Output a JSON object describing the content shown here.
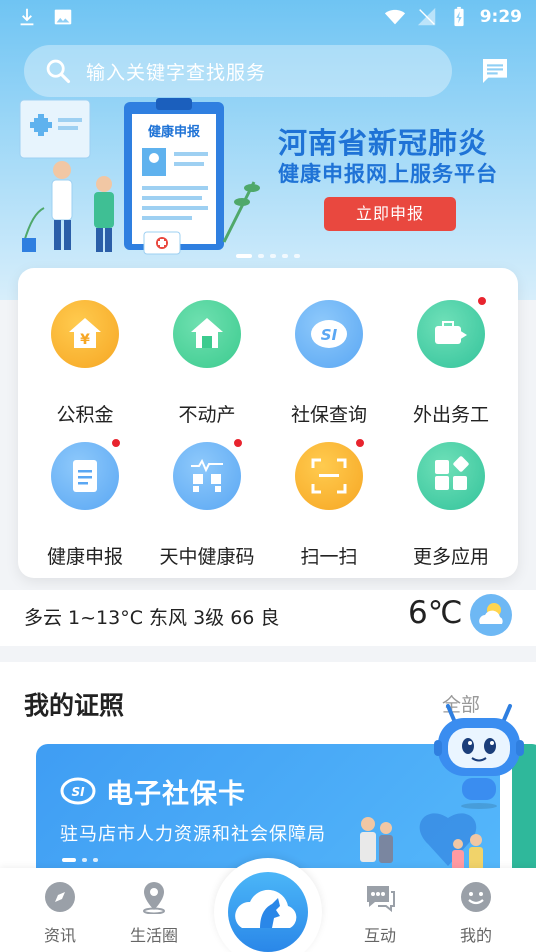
{
  "status_bar": {
    "time": "9:29"
  },
  "search": {
    "placeholder": "输入关键字查找服务"
  },
  "banner": {
    "title_line1": "河南省新冠肺炎",
    "title_line2": "健康申报网上服务平台",
    "button_label": "立即申报",
    "illustration_label": "健康申报"
  },
  "services": [
    {
      "label": "公积金",
      "icon": "yuan-house-icon",
      "color": "#f6a623",
      "badge": false
    },
    {
      "label": "不动产",
      "icon": "house-icon",
      "color": "#3ccb8f",
      "badge": false
    },
    {
      "label": "社保查询",
      "icon": "si-icon",
      "color": "#5aa7f3",
      "badge": false
    },
    {
      "label": "外出务工",
      "icon": "briefcase-icon",
      "color": "#33c39b",
      "badge": true
    },
    {
      "label": "健康申报",
      "icon": "health-report-icon",
      "color": "#5aa7f3",
      "badge": true
    },
    {
      "label": "天中健康码",
      "icon": "qr-code-icon",
      "color": "#5aa7f3",
      "badge": true
    },
    {
      "label": "扫一扫",
      "icon": "scan-icon",
      "color": "#f6a623",
      "badge": true
    },
    {
      "label": "更多应用",
      "icon": "more-apps-icon",
      "color": "#33c39b",
      "badge": false
    }
  ],
  "weather": {
    "description": "多云  1~13°C  东风 3级  66 良",
    "temperature": "6℃"
  },
  "certificates": {
    "title": "我的证照",
    "all_label": "全部",
    "card": {
      "name": "电子社保卡",
      "org": "驻马店市人力资源和社会保障局"
    }
  },
  "bottom_nav": [
    {
      "label": "资讯",
      "icon": "compass-icon"
    },
    {
      "label": "生活圈",
      "icon": "location-pin-icon"
    },
    {
      "label": "互动",
      "icon": "chat-icon"
    },
    {
      "label": "我的",
      "icon": "smiley-icon"
    }
  ],
  "colors": {
    "accent": "#1f73d6",
    "cta": "#e9483f",
    "badge": "#e8242e"
  }
}
